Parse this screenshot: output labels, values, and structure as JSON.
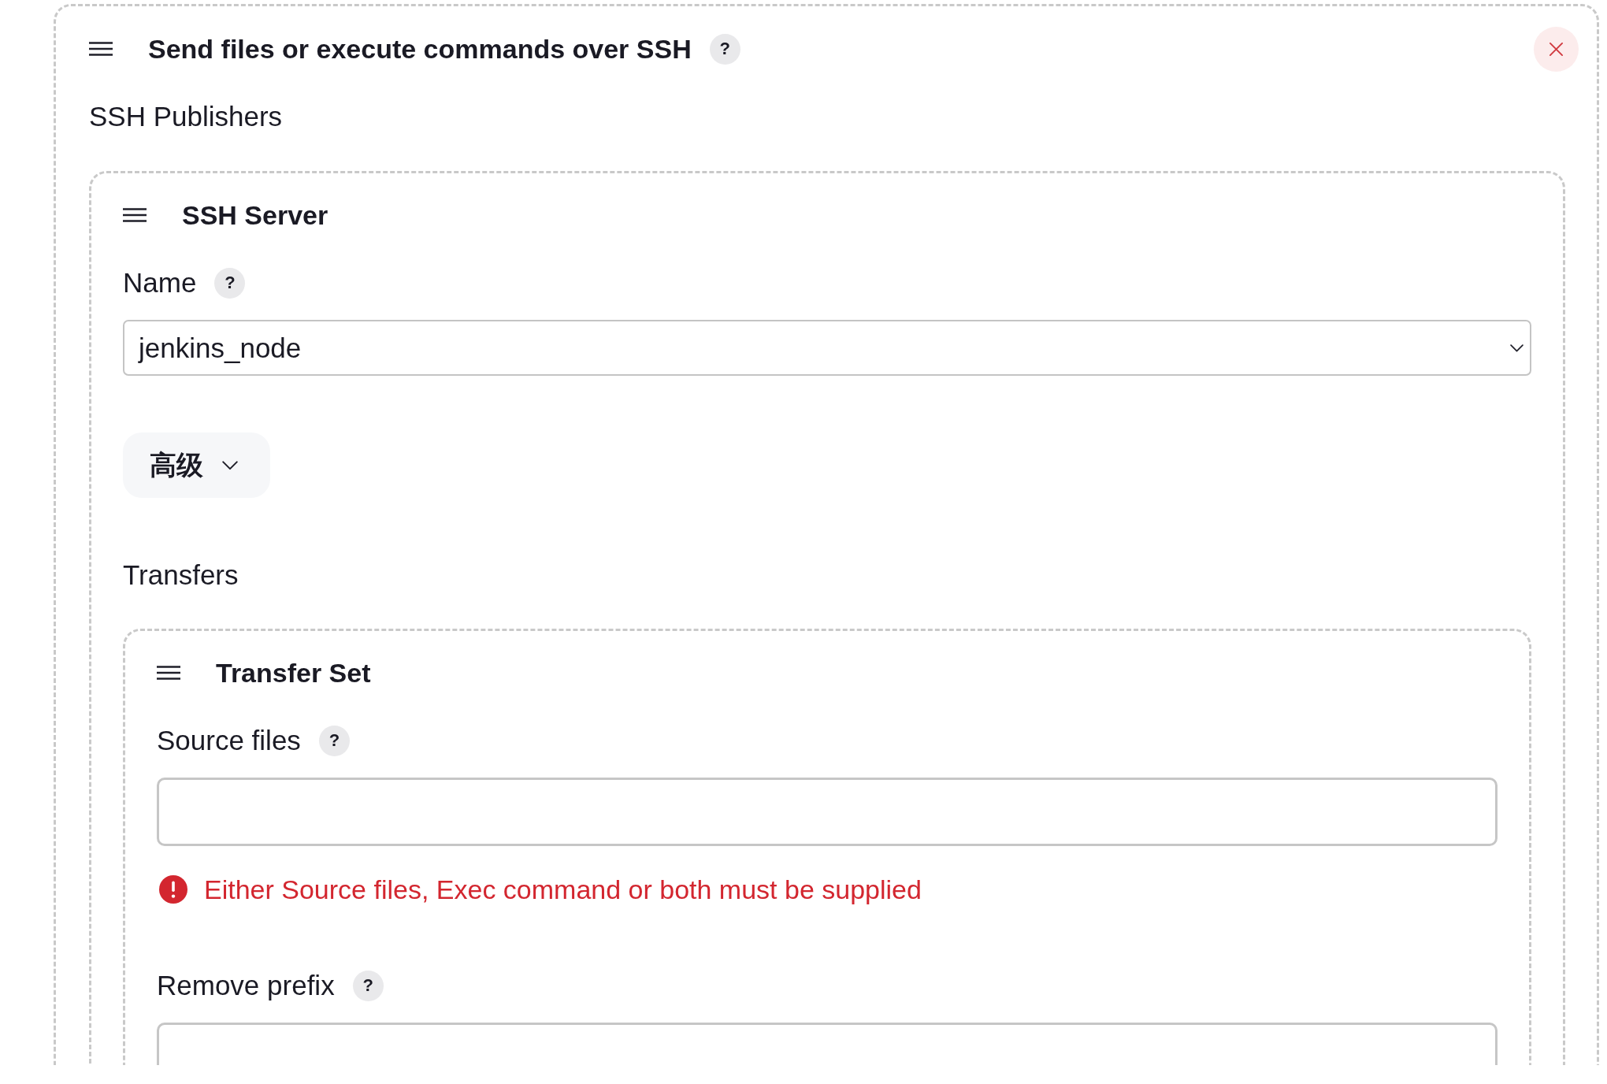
{
  "panel": {
    "title": "Send files or execute commands over SSH",
    "help": "?",
    "section_label": "SSH Publishers",
    "ssh_servers": [
      {
        "title": "SSH Server",
        "name_field": {
          "label": "Name",
          "help": "?",
          "value": "jenkins_node"
        },
        "advanced_button": "高级",
        "transfers_label": "Transfers",
        "transfer_sets": [
          {
            "title": "Transfer Set",
            "fields": [
              {
                "label": "Source files",
                "help": "?",
                "error": "Either Source files, Exec command or both must be supplied"
              },
              {
                "label": "Remove prefix",
                "help": "?"
              }
            ]
          }
        ]
      }
    ]
  }
}
